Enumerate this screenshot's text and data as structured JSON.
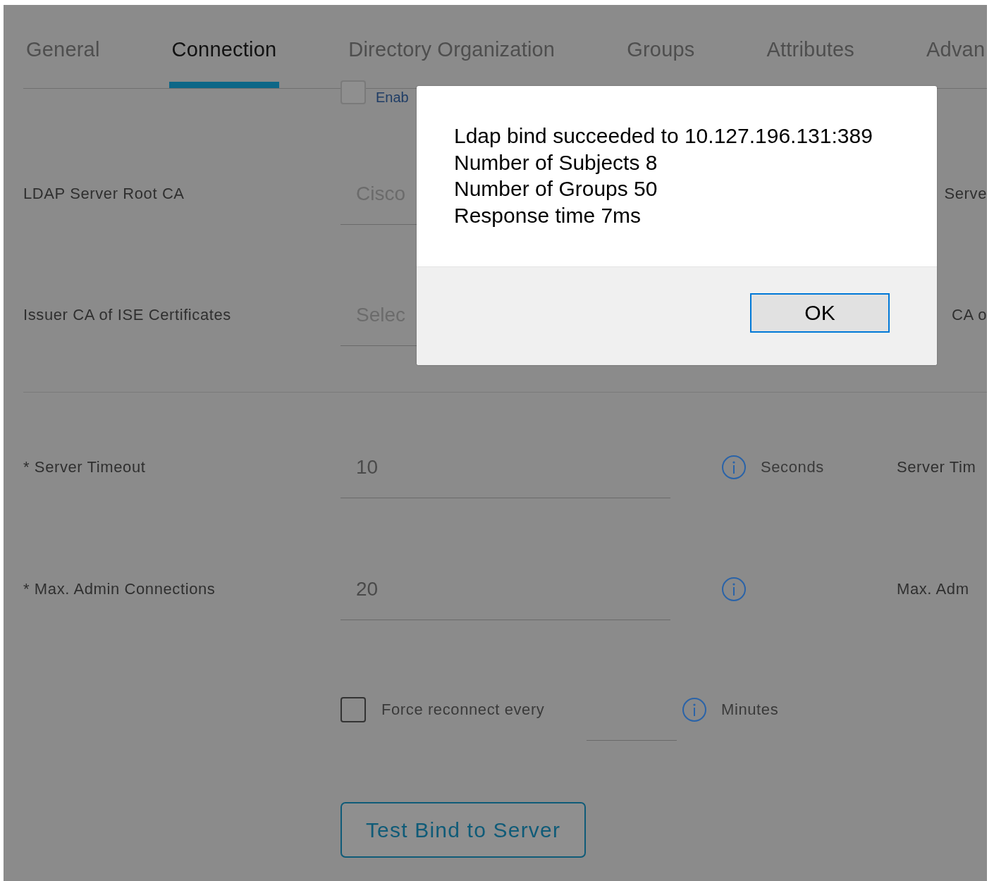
{
  "tabs": [
    {
      "label": "General",
      "selected": false
    },
    {
      "label": "Connection",
      "selected": true
    },
    {
      "label": "Directory Organization",
      "selected": false
    },
    {
      "label": "Groups",
      "selected": false
    },
    {
      "label": "Attributes",
      "selected": false
    },
    {
      "label": "Advan",
      "selected": false
    }
  ],
  "enable_option": {
    "label": "Enab",
    "checked": false
  },
  "fields": [
    {
      "kind": "select",
      "label": "LDAP Server Root CA",
      "placeholder": "Cisco",
      "help": "Serve"
    },
    {
      "kind": "select",
      "label": "Issuer CA of ISE Certificates",
      "placeholder": "Selec",
      "help": "CA o"
    },
    {
      "kind": "number",
      "label": "* Server Timeout",
      "value": "10",
      "unit": "Seconds",
      "help": "Server Tim"
    },
    {
      "kind": "number",
      "label": "* Max. Admin Connections",
      "value": "20",
      "help": "Max. Adm"
    }
  ],
  "force_reconnect": {
    "label": "Force reconnect every",
    "checked": false,
    "unit": "Minutes"
  },
  "test_button": "Test Bind to Server",
  "dialog": {
    "lines": [
      "Ldap bind succeeded to 10.127.196.131:389",
      "Number of Subjects 8",
      "Number of Groups 50",
      "Response time 7ms"
    ],
    "button": "OK"
  }
}
